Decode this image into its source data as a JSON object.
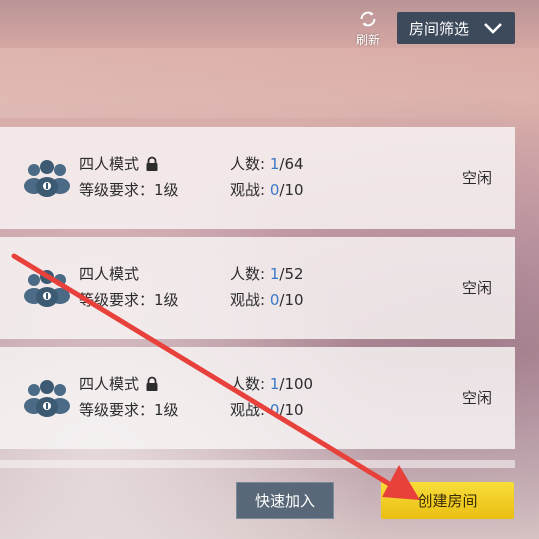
{
  "toolbar": {
    "refresh_label": "刷新",
    "filter_label": "房间筛选"
  },
  "rooms": [
    {
      "mode": "四人模式",
      "locked": true,
      "level": "等级要求：1级",
      "players_label": "人数:",
      "players_current": "1",
      "players_total": "/64",
      "spectators_label": "观战:",
      "spectators_current": "0",
      "spectators_total": "/10",
      "status": "空闲"
    },
    {
      "mode": "四人模式",
      "locked": false,
      "level": "等级要求：1级",
      "players_label": "人数:",
      "players_current": "1",
      "players_total": "/52",
      "spectators_label": "观战:",
      "spectators_current": "0",
      "spectators_total": "/10",
      "status": "空闲"
    },
    {
      "mode": "四人模式",
      "locked": true,
      "level": "等级要求：1级",
      "players_label": "人数:",
      "players_current": "1",
      "players_total": "/100",
      "spectators_label": "观战:",
      "spectators_current": "0",
      "spectators_total": "/10",
      "status": "空闲"
    }
  ],
  "actions": {
    "quick_join": "快速加入",
    "create_room": "创建房间"
  },
  "colors": {
    "accent": "#3c78c8",
    "filter_button": "#3d4a5c",
    "create_button": "#f5d531",
    "annotation_arrow": "#e8403a"
  }
}
